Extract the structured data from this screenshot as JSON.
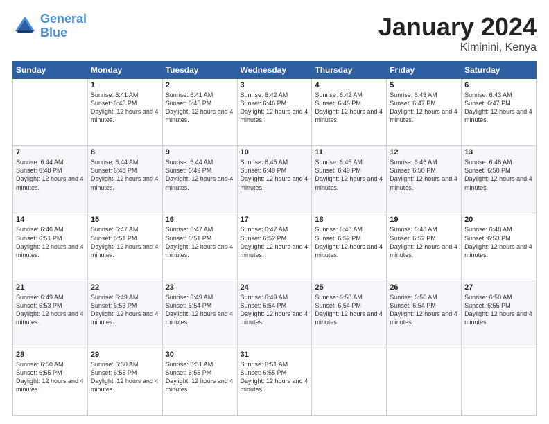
{
  "header": {
    "logo_line1": "General",
    "logo_line2": "Blue",
    "month": "January 2024",
    "location": "Kiminini, Kenya"
  },
  "weekdays": [
    "Sunday",
    "Monday",
    "Tuesday",
    "Wednesday",
    "Thursday",
    "Friday",
    "Saturday"
  ],
  "weeks": [
    [
      {
        "day": "",
        "info": ""
      },
      {
        "day": "1",
        "info": "Sunrise: 6:41 AM\nSunset: 6:45 PM\nDaylight: 12 hours and 4 minutes."
      },
      {
        "day": "2",
        "info": "Sunrise: 6:41 AM\nSunset: 6:45 PM\nDaylight: 12 hours and 4 minutes."
      },
      {
        "day": "3",
        "info": "Sunrise: 6:42 AM\nSunset: 6:46 PM\nDaylight: 12 hours and 4 minutes."
      },
      {
        "day": "4",
        "info": "Sunrise: 6:42 AM\nSunset: 6:46 PM\nDaylight: 12 hours and 4 minutes."
      },
      {
        "day": "5",
        "info": "Sunrise: 6:43 AM\nSunset: 6:47 PM\nDaylight: 12 hours and 4 minutes."
      },
      {
        "day": "6",
        "info": "Sunrise: 6:43 AM\nSunset: 6:47 PM\nDaylight: 12 hours and 4 minutes."
      }
    ],
    [
      {
        "day": "7",
        "info": "Sunrise: 6:44 AM\nSunset: 6:48 PM\nDaylight: 12 hours and 4 minutes."
      },
      {
        "day": "8",
        "info": "Sunrise: 6:44 AM\nSunset: 6:48 PM\nDaylight: 12 hours and 4 minutes."
      },
      {
        "day": "9",
        "info": "Sunrise: 6:44 AM\nSunset: 6:49 PM\nDaylight: 12 hours and 4 minutes."
      },
      {
        "day": "10",
        "info": "Sunrise: 6:45 AM\nSunset: 6:49 PM\nDaylight: 12 hours and 4 minutes."
      },
      {
        "day": "11",
        "info": "Sunrise: 6:45 AM\nSunset: 6:49 PM\nDaylight: 12 hours and 4 minutes."
      },
      {
        "day": "12",
        "info": "Sunrise: 6:46 AM\nSunset: 6:50 PM\nDaylight: 12 hours and 4 minutes."
      },
      {
        "day": "13",
        "info": "Sunrise: 6:46 AM\nSunset: 6:50 PM\nDaylight: 12 hours and 4 minutes."
      }
    ],
    [
      {
        "day": "14",
        "info": "Sunrise: 6:46 AM\nSunset: 6:51 PM\nDaylight: 12 hours and 4 minutes."
      },
      {
        "day": "15",
        "info": "Sunrise: 6:47 AM\nSunset: 6:51 PM\nDaylight: 12 hours and 4 minutes."
      },
      {
        "day": "16",
        "info": "Sunrise: 6:47 AM\nSunset: 6:51 PM\nDaylight: 12 hours and 4 minutes."
      },
      {
        "day": "17",
        "info": "Sunrise: 6:47 AM\nSunset: 6:52 PM\nDaylight: 12 hours and 4 minutes."
      },
      {
        "day": "18",
        "info": "Sunrise: 6:48 AM\nSunset: 6:52 PM\nDaylight: 12 hours and 4 minutes."
      },
      {
        "day": "19",
        "info": "Sunrise: 6:48 AM\nSunset: 6:52 PM\nDaylight: 12 hours and 4 minutes."
      },
      {
        "day": "20",
        "info": "Sunrise: 6:48 AM\nSunset: 6:53 PM\nDaylight: 12 hours and 4 minutes."
      }
    ],
    [
      {
        "day": "21",
        "info": "Sunrise: 6:49 AM\nSunset: 6:53 PM\nDaylight: 12 hours and 4 minutes."
      },
      {
        "day": "22",
        "info": "Sunrise: 6:49 AM\nSunset: 6:53 PM\nDaylight: 12 hours and 4 minutes."
      },
      {
        "day": "23",
        "info": "Sunrise: 6:49 AM\nSunset: 6:54 PM\nDaylight: 12 hours and 4 minutes."
      },
      {
        "day": "24",
        "info": "Sunrise: 6:49 AM\nSunset: 6:54 PM\nDaylight: 12 hours and 4 minutes."
      },
      {
        "day": "25",
        "info": "Sunrise: 6:50 AM\nSunset: 6:54 PM\nDaylight: 12 hours and 4 minutes."
      },
      {
        "day": "26",
        "info": "Sunrise: 6:50 AM\nSunset: 6:54 PM\nDaylight: 12 hours and 4 minutes."
      },
      {
        "day": "27",
        "info": "Sunrise: 6:50 AM\nSunset: 6:55 PM\nDaylight: 12 hours and 4 minutes."
      }
    ],
    [
      {
        "day": "28",
        "info": "Sunrise: 6:50 AM\nSunset: 6:55 PM\nDaylight: 12 hours and 4 minutes."
      },
      {
        "day": "29",
        "info": "Sunrise: 6:50 AM\nSunset: 6:55 PM\nDaylight: 12 hours and 4 minutes."
      },
      {
        "day": "30",
        "info": "Sunrise: 6:51 AM\nSunset: 6:55 PM\nDaylight: 12 hours and 4 minutes."
      },
      {
        "day": "31",
        "info": "Sunrise: 6:51 AM\nSunset: 6:55 PM\nDaylight: 12 hours and 4 minutes."
      },
      {
        "day": "",
        "info": ""
      },
      {
        "day": "",
        "info": ""
      },
      {
        "day": "",
        "info": ""
      }
    ]
  ]
}
